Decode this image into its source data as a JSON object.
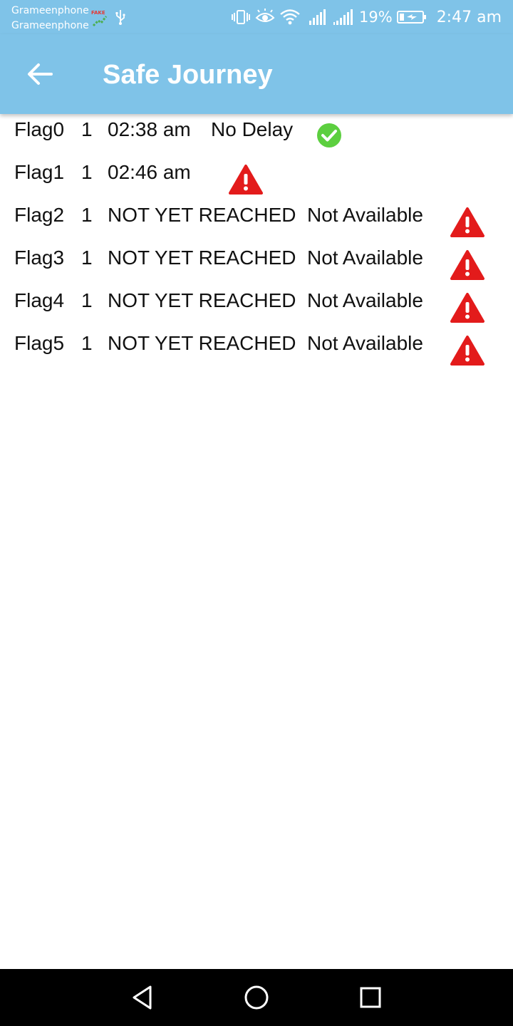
{
  "status_bar": {
    "carrier1": "Grameenphone",
    "carrier2": "Grameenphone",
    "fake_badge": "FAKE",
    "battery": "19%",
    "time": "2:47 am",
    "icons": [
      "mock-location-icon",
      "usb-icon",
      "vibrate-icon",
      "eye-comfort-icon",
      "wifi-icon",
      "signal-icon",
      "signal-icon",
      "battery-charging-icon"
    ]
  },
  "app_bar": {
    "title": "Safe Journey",
    "back_icon": "arrow-back-icon",
    "background": "#7fc3e8"
  },
  "flags": [
    {
      "name": "Flag0",
      "count": "1",
      "time": "02:38 am",
      "delay": "No Delay",
      "status": "ok"
    },
    {
      "name": "Flag1",
      "count": "1",
      "time": "02:46 am",
      "delay": "",
      "status": "warning"
    },
    {
      "name": "Flag2",
      "count": "1",
      "time": "NOT YET REACHED",
      "delay": "Not Available",
      "status": "warning"
    },
    {
      "name": "Flag3",
      "count": "1",
      "time": "NOT YET REACHED",
      "delay": "Not Available",
      "status": "warning"
    },
    {
      "name": "Flag4",
      "count": "1",
      "time": "NOT YET REACHED",
      "delay": "Not Available",
      "status": "warning"
    },
    {
      "name": "Flag5",
      "count": "1",
      "time": "NOT YET REACHED",
      "delay": "Not Available",
      "status": "warning"
    }
  ],
  "status_colors": {
    "ok": "#5ccf3f",
    "warning": "#e31b1b"
  },
  "nav_bar": {
    "icons": [
      "back-triangle-icon",
      "home-circle-icon",
      "recents-square-icon"
    ]
  }
}
